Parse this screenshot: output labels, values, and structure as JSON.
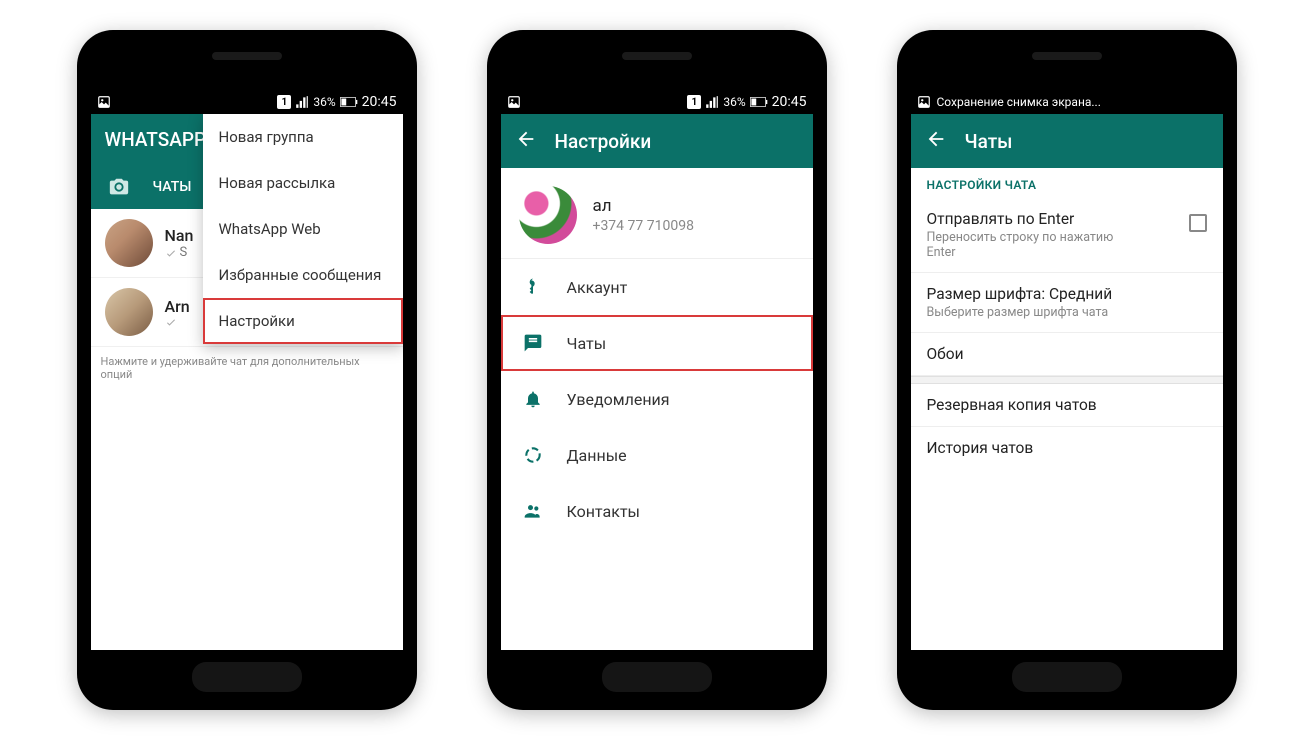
{
  "status": {
    "sim_indicator": "1",
    "battery_text": "36%",
    "time": "20:45",
    "toast_screen3": "Сохранение снимка экрана..."
  },
  "screen1": {
    "app_title": "WHATSAPP",
    "tab_chats": "ЧАТЫ",
    "chat1_name": "Nan",
    "chat1_sub": "S",
    "chat2_name": "Arn",
    "chat2_sub": "",
    "hint": "Нажмите и удерживайте чат для дополнительных опций",
    "menu": {
      "new_group": "Новая группа",
      "new_broadcast": "Новая рассылка",
      "whatsapp_web": "WhatsApp Web",
      "starred": "Избранные сообщения",
      "settings": "Настройки"
    }
  },
  "screen2": {
    "title": "Настройки",
    "profile_name": "ал",
    "profile_phone": "+374 77 710098",
    "item_account": "Аккаунт",
    "item_chats": "Чаты",
    "item_notifications": "Уведомления",
    "item_data": "Данные",
    "item_contacts": "Контакты"
  },
  "screen3": {
    "title": "Чаты",
    "section": "НАСТРОЙКИ ЧАТА",
    "enter_send_title": "Отправлять по Enter",
    "enter_send_sub": "Переносить строку по нажатию Enter",
    "font_title": "Размер шрифта: Средний",
    "font_sub": "Выберите размер шрифта чата",
    "wallpaper": "Обои",
    "backup": "Резервная копия чатов",
    "history": "История чатов"
  }
}
